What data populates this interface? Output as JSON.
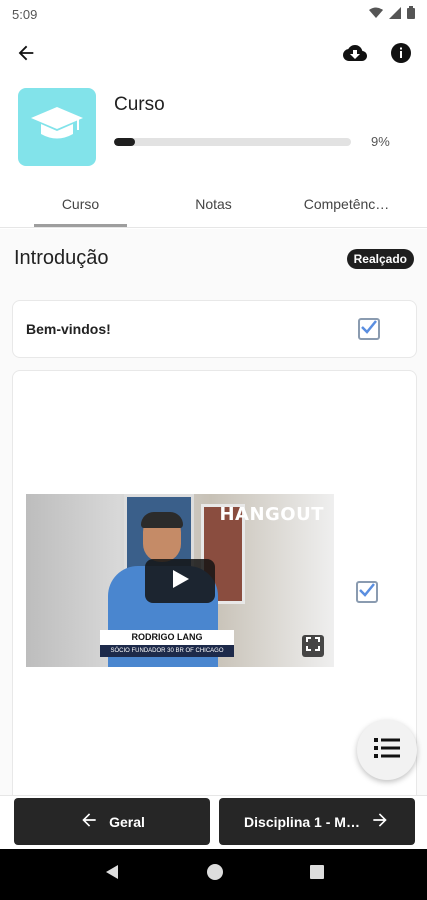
{
  "status_bar": {
    "time": "5:09"
  },
  "course": {
    "title": "Curso",
    "progress_fraction": 0.09,
    "progress_label": "9%"
  },
  "tabs": [
    {
      "label": "Curso",
      "active": true
    },
    {
      "label": "Notas",
      "active": false
    },
    {
      "label": "Competênc…",
      "active": false
    }
  ],
  "section": {
    "title": "Introdução",
    "badge": "Realçado"
  },
  "items": [
    {
      "label": "Bem-vindos!",
      "completed": true
    },
    {
      "type": "video",
      "completed": true,
      "video_brand": "HANGOUT",
      "video_name": "RODRIGO LANG",
      "video_role": "SÓCIO FUNDADOR 30 BR OF CHICAGO"
    }
  ],
  "bottom_nav": {
    "prev_label": "Geral",
    "next_label": "Disciplina 1 - M…"
  },
  "icons": {
    "back": "arrow-left-icon",
    "download": "cloud-download-icon",
    "info": "info-icon",
    "course": "graduation-cap-icon",
    "fab": "list-icon",
    "play": "play-icon",
    "fullscreen": "fullscreen-icon"
  },
  "colors": {
    "thumb": "#82e3ea",
    "primary_dark": "#262626",
    "checkbox": "#5a8ee0"
  }
}
